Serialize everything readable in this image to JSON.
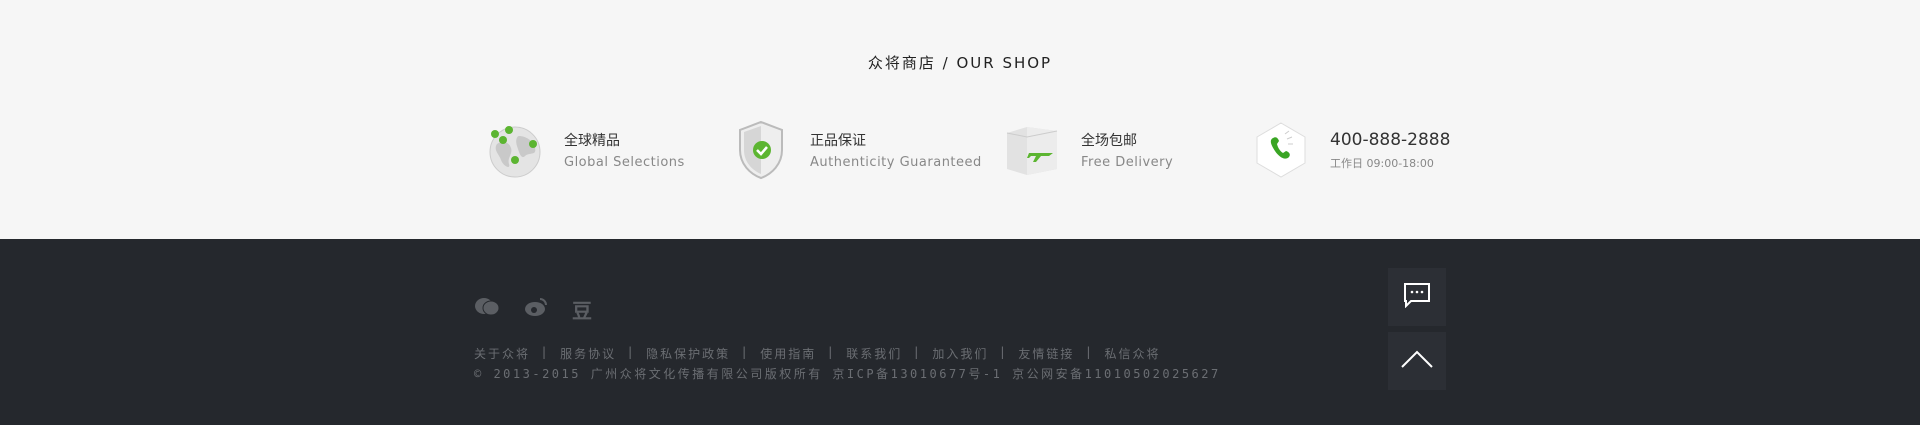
{
  "shop": {
    "title": "众将商店 / OUR SHOP",
    "features": [
      {
        "title": "全球精品",
        "subtitle": "Global Selections",
        "icon": "globe-icon"
      },
      {
        "title": "正品保证",
        "subtitle": "Authenticity Guaranteed",
        "icon": "shield-check-icon"
      },
      {
        "title": "全场包邮",
        "subtitle": "Free Delivery",
        "icon": "box-plane-icon"
      }
    ],
    "contact": {
      "phone": "400-888-2888",
      "hours": "工作日 09:00-18:00",
      "icon": "phone-icon"
    }
  },
  "footer": {
    "social": [
      {
        "icon": "wechat-icon"
      },
      {
        "icon": "weibo-icon"
      },
      {
        "icon": "douban-icon",
        "label": "豆"
      }
    ],
    "links": [
      "关于众将",
      "服务协议",
      "隐私保护政策",
      "使用指南",
      "联系我们",
      "加入我们",
      "友情链接",
      "私信众将"
    ],
    "copyright": "© 2013-2015 广州众将文化传播有限公司版权所有 京ICP备13010677号-1 京公网安备11010502025627"
  },
  "side": {
    "chat_icon": "chat-icon",
    "top_icon": "back-to-top-icon"
  },
  "colors": {
    "accent": "#5cb531",
    "footer_bg": "#25282d",
    "top_bg": "#f6f6f6"
  }
}
